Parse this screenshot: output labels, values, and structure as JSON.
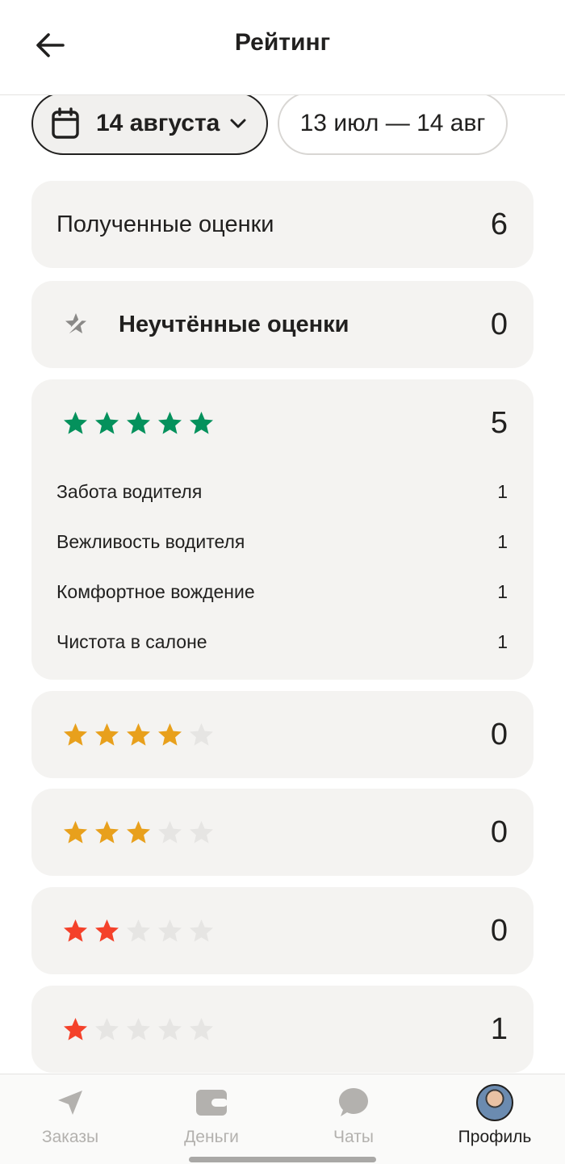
{
  "header": {
    "title": "Рейтинг",
    "back_icon": "arrow-left-icon"
  },
  "period": {
    "selected_date": "14 августа",
    "range_label": "13 июл — 14 авг"
  },
  "received": {
    "label": "Полученные оценки",
    "value": "6"
  },
  "unaccounted": {
    "label": "Неучтённые оценки",
    "value": "0",
    "icon": "star-slash-icon"
  },
  "ratings": [
    {
      "stars": 5,
      "value": "5",
      "color": "#04915c",
      "details": [
        {
          "label": "Забота водителя",
          "value": "1"
        },
        {
          "label": "Вежливость водителя",
          "value": "1"
        },
        {
          "label": "Комфортное вождение",
          "value": "1"
        },
        {
          "label": "Чистота в салоне",
          "value": "1"
        }
      ]
    },
    {
      "stars": 4,
      "value": "0",
      "color": "#e8a01c"
    },
    {
      "stars": 3,
      "value": "0",
      "color": "#e8a01c"
    },
    {
      "stars": 2,
      "value": "0",
      "color": "#f4412a"
    },
    {
      "stars": 1,
      "value": "1",
      "color": "#f4412a"
    }
  ],
  "empty_star_color": "#e6e5e3",
  "nav": [
    {
      "label": "Заказы",
      "icon": "navigation-arrow-icon"
    },
    {
      "label": "Деньги",
      "icon": "wallet-icon"
    },
    {
      "label": "Чаты",
      "icon": "chat-bubble-icon"
    },
    {
      "label": "Профиль",
      "icon": "avatar",
      "active": true
    }
  ]
}
